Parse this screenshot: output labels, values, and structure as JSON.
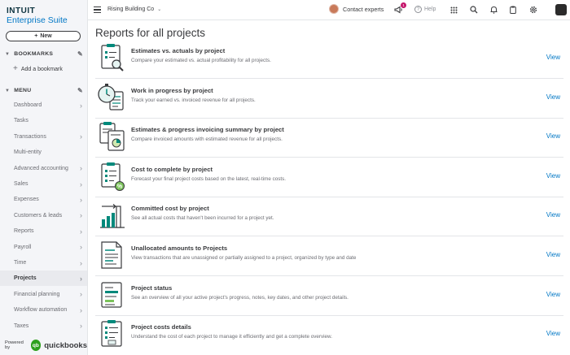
{
  "brand": {
    "name": "INTUIT",
    "product": "Enterprise Suite"
  },
  "new_button": {
    "label": "New",
    "icon": "plus-icon"
  },
  "bookmarks": {
    "header": "BOOKMARKS",
    "add_label": "Add a bookmark"
  },
  "menu": {
    "header": "MENU",
    "items": [
      {
        "label": "Dashboard",
        "has_arrow": true
      },
      {
        "label": "Tasks",
        "has_arrow": false
      },
      {
        "label": "Transactions",
        "has_arrow": true
      },
      {
        "label": "Multi-entity",
        "has_arrow": false
      },
      {
        "label": "Advanced accounting",
        "has_arrow": true
      },
      {
        "label": "Sales",
        "has_arrow": true
      },
      {
        "label": "Expenses",
        "has_arrow": true
      },
      {
        "label": "Customers & leads",
        "has_arrow": true
      },
      {
        "label": "Reports",
        "has_arrow": true
      },
      {
        "label": "Payroll",
        "has_arrow": true
      },
      {
        "label": "Time",
        "has_arrow": true
      },
      {
        "label": "Projects",
        "has_arrow": true,
        "active": true
      },
      {
        "label": "Financial planning",
        "has_arrow": true
      },
      {
        "label": "Workflow automation",
        "has_arrow": true
      },
      {
        "label": "Taxes",
        "has_arrow": true
      }
    ]
  },
  "powered_by": {
    "label": "Powered by",
    "logo_text": "qb",
    "brand": "quickbooks"
  },
  "topbar": {
    "company": "Rising Building Co",
    "contact_label": "Contact experts",
    "notification_count": "1",
    "help_label": "Help"
  },
  "page": {
    "title": "Reports for all projects",
    "view_label": "View",
    "reports": [
      {
        "title": "Estimates vs. actuals by project",
        "description": "Compare your estimated vs. actual profitability for all projects.",
        "icon": "magnifier-report-icon"
      },
      {
        "title": "Work in progress by project",
        "description": "Track your earned vs. invoiced revenue for all projects.",
        "icon": "stopwatch-report-icon"
      },
      {
        "title": "Estimates & progress invoicing summary by project",
        "description": "Compare invoiced amounts with estimated revenue for all projects.",
        "icon": "pie-report-icon"
      },
      {
        "title": "Cost to complete by project",
        "description": "Forecast your final project costs based on the latest, real-time costs.",
        "icon": "percent-report-icon"
      },
      {
        "title": "Committed cost by project",
        "description": "See all actual costs that haven't been incurred for a project yet.",
        "icon": "bar-chart-report-icon"
      },
      {
        "title": "Unallocated amounts to Projects",
        "description": "View transactions that are unassigned or partially assigned to a project, organized by type and date",
        "icon": "document-report-icon"
      },
      {
        "title": "Project status",
        "description": "See an overview of all your active project's progress, notes, key dates, and other project details.",
        "icon": "status-report-icon"
      },
      {
        "title": "Project costs details",
        "description": "Understand the cost of each project to manage it efficiently and get a complete overview.",
        "icon": "checklist-report-icon"
      }
    ]
  },
  "colors": {
    "accent": "#0077c5",
    "brand_green": "#2ca01c",
    "icon_teal": "#00897b"
  }
}
